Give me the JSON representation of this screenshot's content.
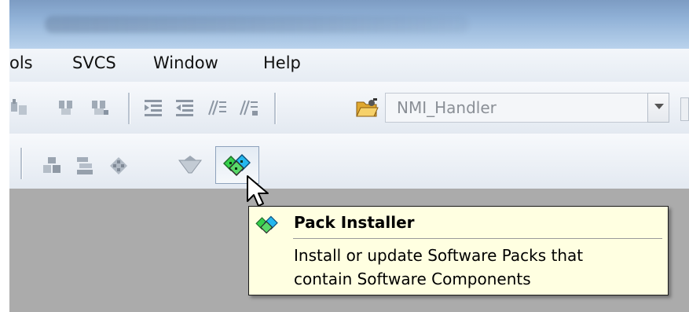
{
  "menu": {
    "items": [
      {
        "label": "ols"
      },
      {
        "label": "SVCS"
      },
      {
        "label": "Window"
      },
      {
        "label": "Help"
      }
    ]
  },
  "toolbar1": {
    "icons": [
      "find-in-files-icon",
      "find-icon",
      "find-next-icon",
      "indent-icon",
      "unindent-icon",
      "comment-icon",
      "uncomment-icon",
      "open-folder-icon"
    ],
    "combo_value": "NMI_Handler"
  },
  "toolbar2": {
    "icons": [
      "manage-components-icon",
      "select-software-packs-icon",
      "manage-run-time-environment-icon",
      "pack-filter-icon",
      "pack-installer-icon"
    ]
  },
  "tooltip": {
    "title": "Pack Installer",
    "lines": [
      "Install or update Software Packs that",
      "contain Software Components"
    ]
  },
  "colors": {
    "tooltip_bg": "#ffffe1",
    "workspace": "#ababab",
    "accent_green": "#2ecc40",
    "accent_blue": "#22aaee"
  }
}
